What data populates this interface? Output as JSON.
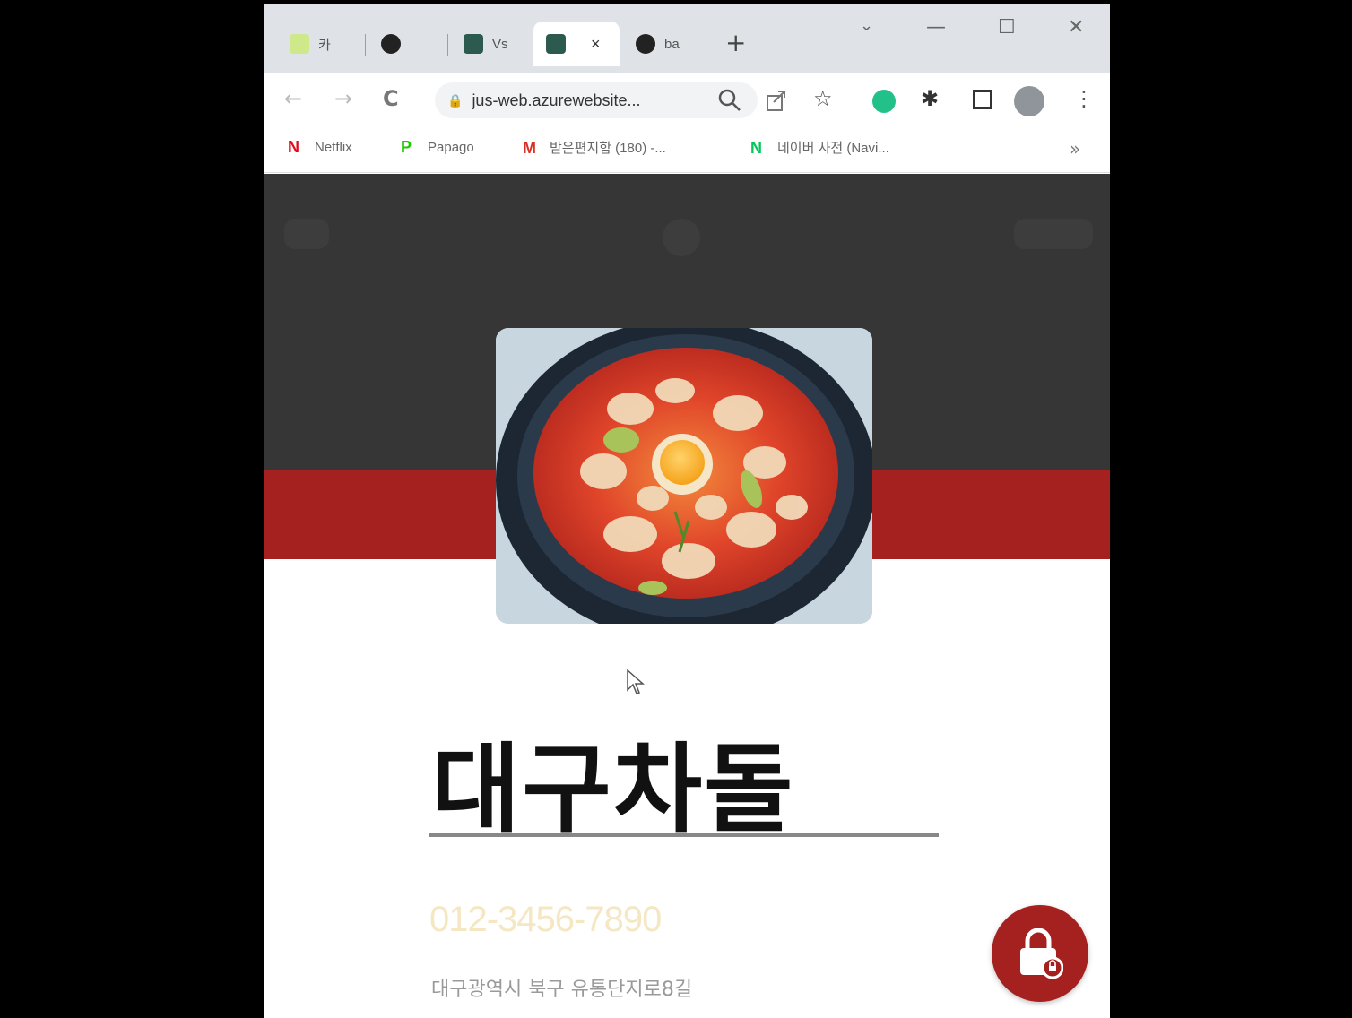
{
  "browser": {
    "tabs": [
      {
        "label": "카",
        "favicon_color": "#34a853"
      },
      {
        "label": " ",
        "favicon_color": "#222222"
      },
      {
        "label": "Vs",
        "favicon_color": "#2d5a4f"
      },
      {
        "label": "",
        "favicon_color": "#2d5a4f"
      },
      {
        "label": "ba",
        "favicon_color": "#222222"
      }
    ],
    "active_tab_close": "×",
    "new_tab": "+",
    "window_controls": {
      "minimize": "—",
      "maximize": "☐",
      "close": "✕",
      "dropdown": "⌄"
    },
    "nav": {
      "back": "←",
      "forward": "→",
      "reload": "C"
    },
    "address": "jus-web.azurewebsite...",
    "bookmarks": [
      {
        "label": "Netflix",
        "icon": "N",
        "color": "#e50914"
      },
      {
        "label": "Papago",
        "icon": "P",
        "color": "#1ec800"
      },
      {
        "label": "받은편지함 (180) -...",
        "icon": "M",
        "color": "#d93025"
      },
      {
        "label": "네이버 사전 (Navi...",
        "icon": "N",
        "color": "#03c75a"
      }
    ],
    "bookmarks_more": "»"
  },
  "restaurant": {
    "name": "대구차돌",
    "phone": "012-3456-7890",
    "address": "대구광역시 북구 유통단지로8길"
  },
  "colors": {
    "accent_red": "#a5211f",
    "hero_dark": "#363636",
    "phone_text": "#f4e7c2"
  }
}
